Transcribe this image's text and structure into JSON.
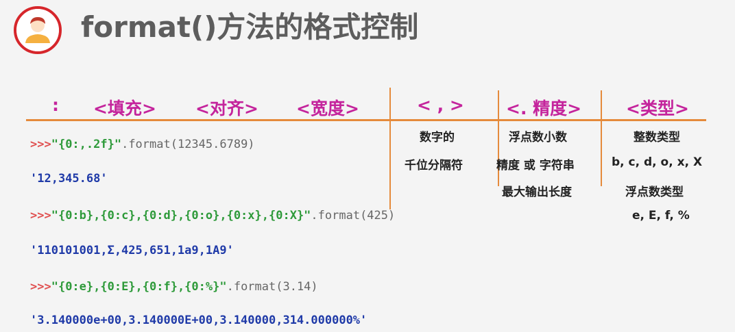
{
  "title": "format()方法的格式控制",
  "header": {
    "colon": ":",
    "fill": "<填充>",
    "align": "<对齐>",
    "width": "<宽度>",
    "comma": "< , >",
    "precision": "<. 精度>",
    "type": "<类型>"
  },
  "descriptions": {
    "comma": [
      "数字的",
      "千位分隔符"
    ],
    "precision": [
      "浮点数小数",
      "精度 或 字符串",
      "最大输出长度"
    ],
    "type": [
      "整数类型",
      "b, c, d, o, x, X",
      "浮点数类型",
      "e, E, f, %"
    ]
  },
  "examples": [
    {
      "prompt": ">>>",
      "fmt": "\"{0:,.2f}\"",
      "call": ".format(12345.6789)",
      "result": "'12,345.68'"
    },
    {
      "prompt": ">>>",
      "fmt": "\"{0:b},{0:c},{0:d},{0:o},{0:x},{0:X}\"",
      "call": ".format(425)",
      "result": "'110101001,Ʃ,425,651,1a9,1A9'"
    },
    {
      "prompt": ">>>",
      "fmt": "\"{0:e},{0:E},{0:f},{0:%}\"",
      "call": ".format(3.14)",
      "result": "'3.140000e+00,3.140000E+00,3.140000,314.000000%'"
    }
  ]
}
